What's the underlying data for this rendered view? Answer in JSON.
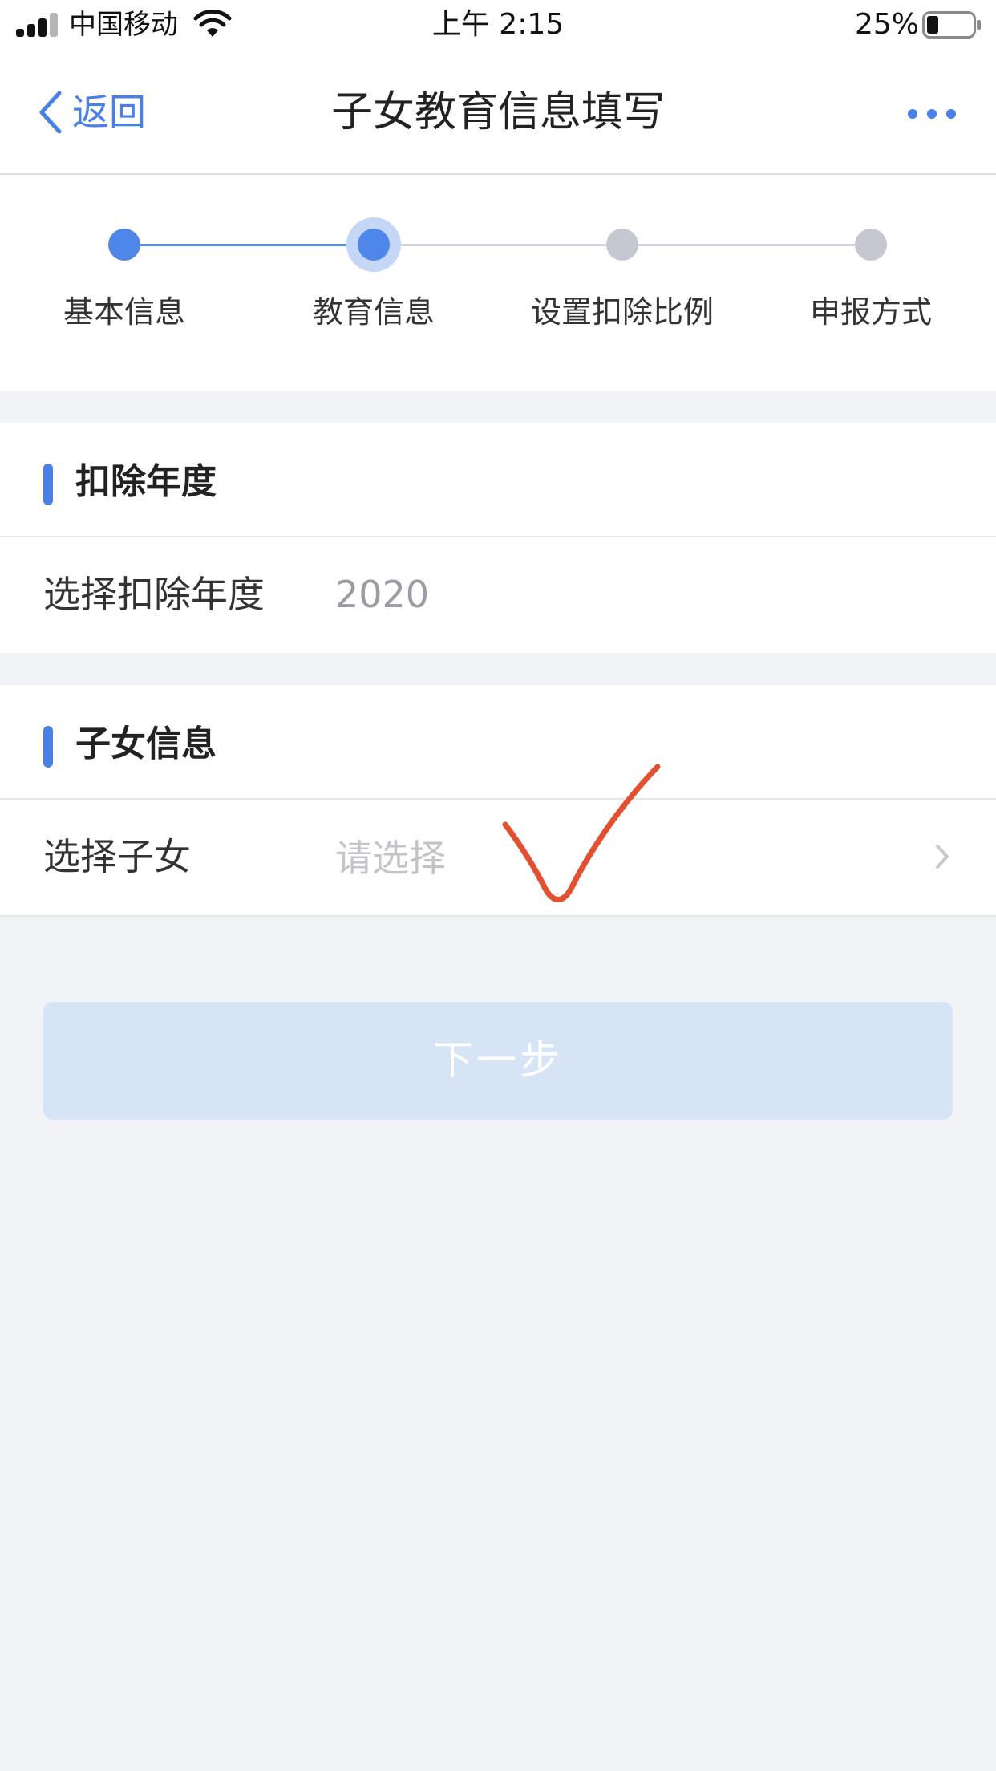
{
  "status_bar": {
    "carrier": "中国移动",
    "time": "上午 2:15",
    "battery_percent": "25%",
    "battery_level": 0.25
  },
  "nav": {
    "back_label": "返回",
    "title": "子女教育信息填写",
    "accent_color": "#4a7fe6"
  },
  "stepper": {
    "current_step": 2,
    "steps": [
      {
        "label": "基本信息",
        "state": "done"
      },
      {
        "label": "教育信息",
        "state": "active"
      },
      {
        "label": "设置扣除比例",
        "state": "todo"
      },
      {
        "label": "申报方式",
        "state": "todo"
      }
    ]
  },
  "sections": {
    "year": {
      "title": "扣除年度",
      "row_label": "选择扣除年度",
      "row_value": "2020"
    },
    "child": {
      "title": "子女信息",
      "row_label": "选择子女",
      "row_placeholder": "请选择"
    }
  },
  "next_button": {
    "label": "下一步",
    "enabled": false
  },
  "annotation": {
    "type": "hand-drawn checkmark",
    "color": "#e2502f"
  }
}
